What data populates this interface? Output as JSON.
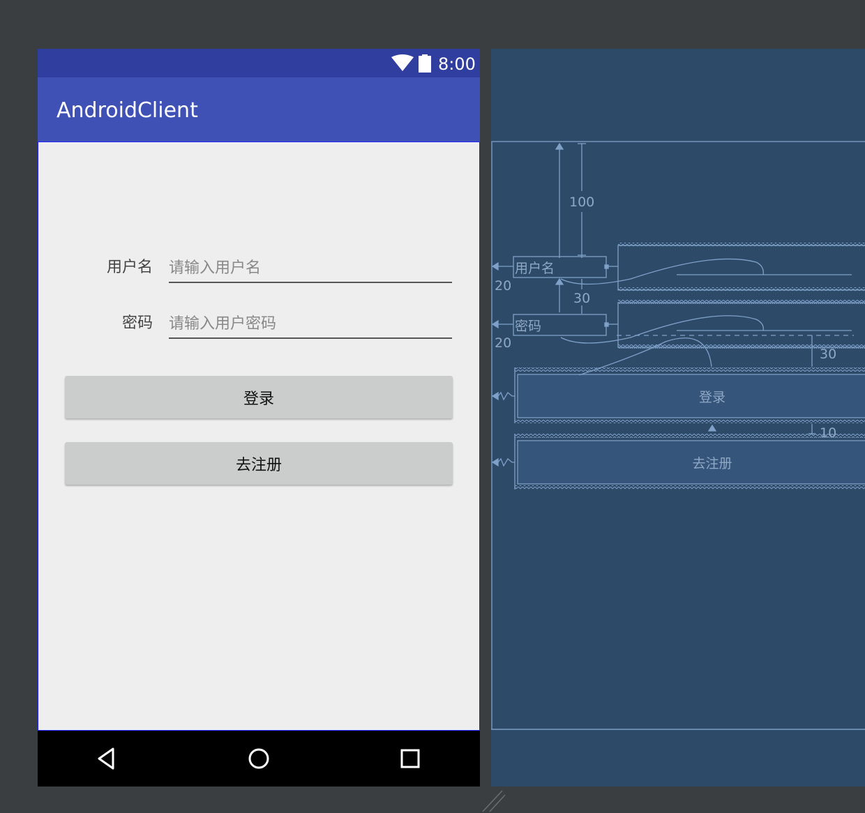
{
  "status_bar": {
    "time": "8:00",
    "wifi_icon": "wifi-icon",
    "battery_icon": "battery-icon"
  },
  "app_bar": {
    "title": "AndroidClient"
  },
  "form": {
    "username_label": "用户名",
    "username_placeholder": "请输入用户名",
    "username_value": "",
    "password_label": "密码",
    "password_placeholder": "请输入用户密码",
    "password_value": "",
    "login_button": "登录",
    "register_button": "去注册"
  },
  "nav_bar": {
    "back_icon": "back-triangle-icon",
    "home_icon": "home-circle-icon",
    "recents_icon": "recents-square-icon"
  },
  "blueprint": {
    "margin_top": "100",
    "margin_left_username": "20",
    "margin_between_fields": "30",
    "margin_left_password": "20",
    "margin_below_password": "30",
    "margin_between_buttons": "10",
    "username_label": "用户名",
    "password_label": "密码",
    "login_button": "登录",
    "register_button": "去注册"
  },
  "colors": {
    "status_bar": "#303f9f",
    "app_bar": "#3f51b5",
    "content_bg": "#eeeeee",
    "button_bg": "#cbcccc",
    "blueprint_bg": "#2d4a69",
    "blueprint_line": "#7fa0c8",
    "editor_bg": "#3b3e41"
  }
}
